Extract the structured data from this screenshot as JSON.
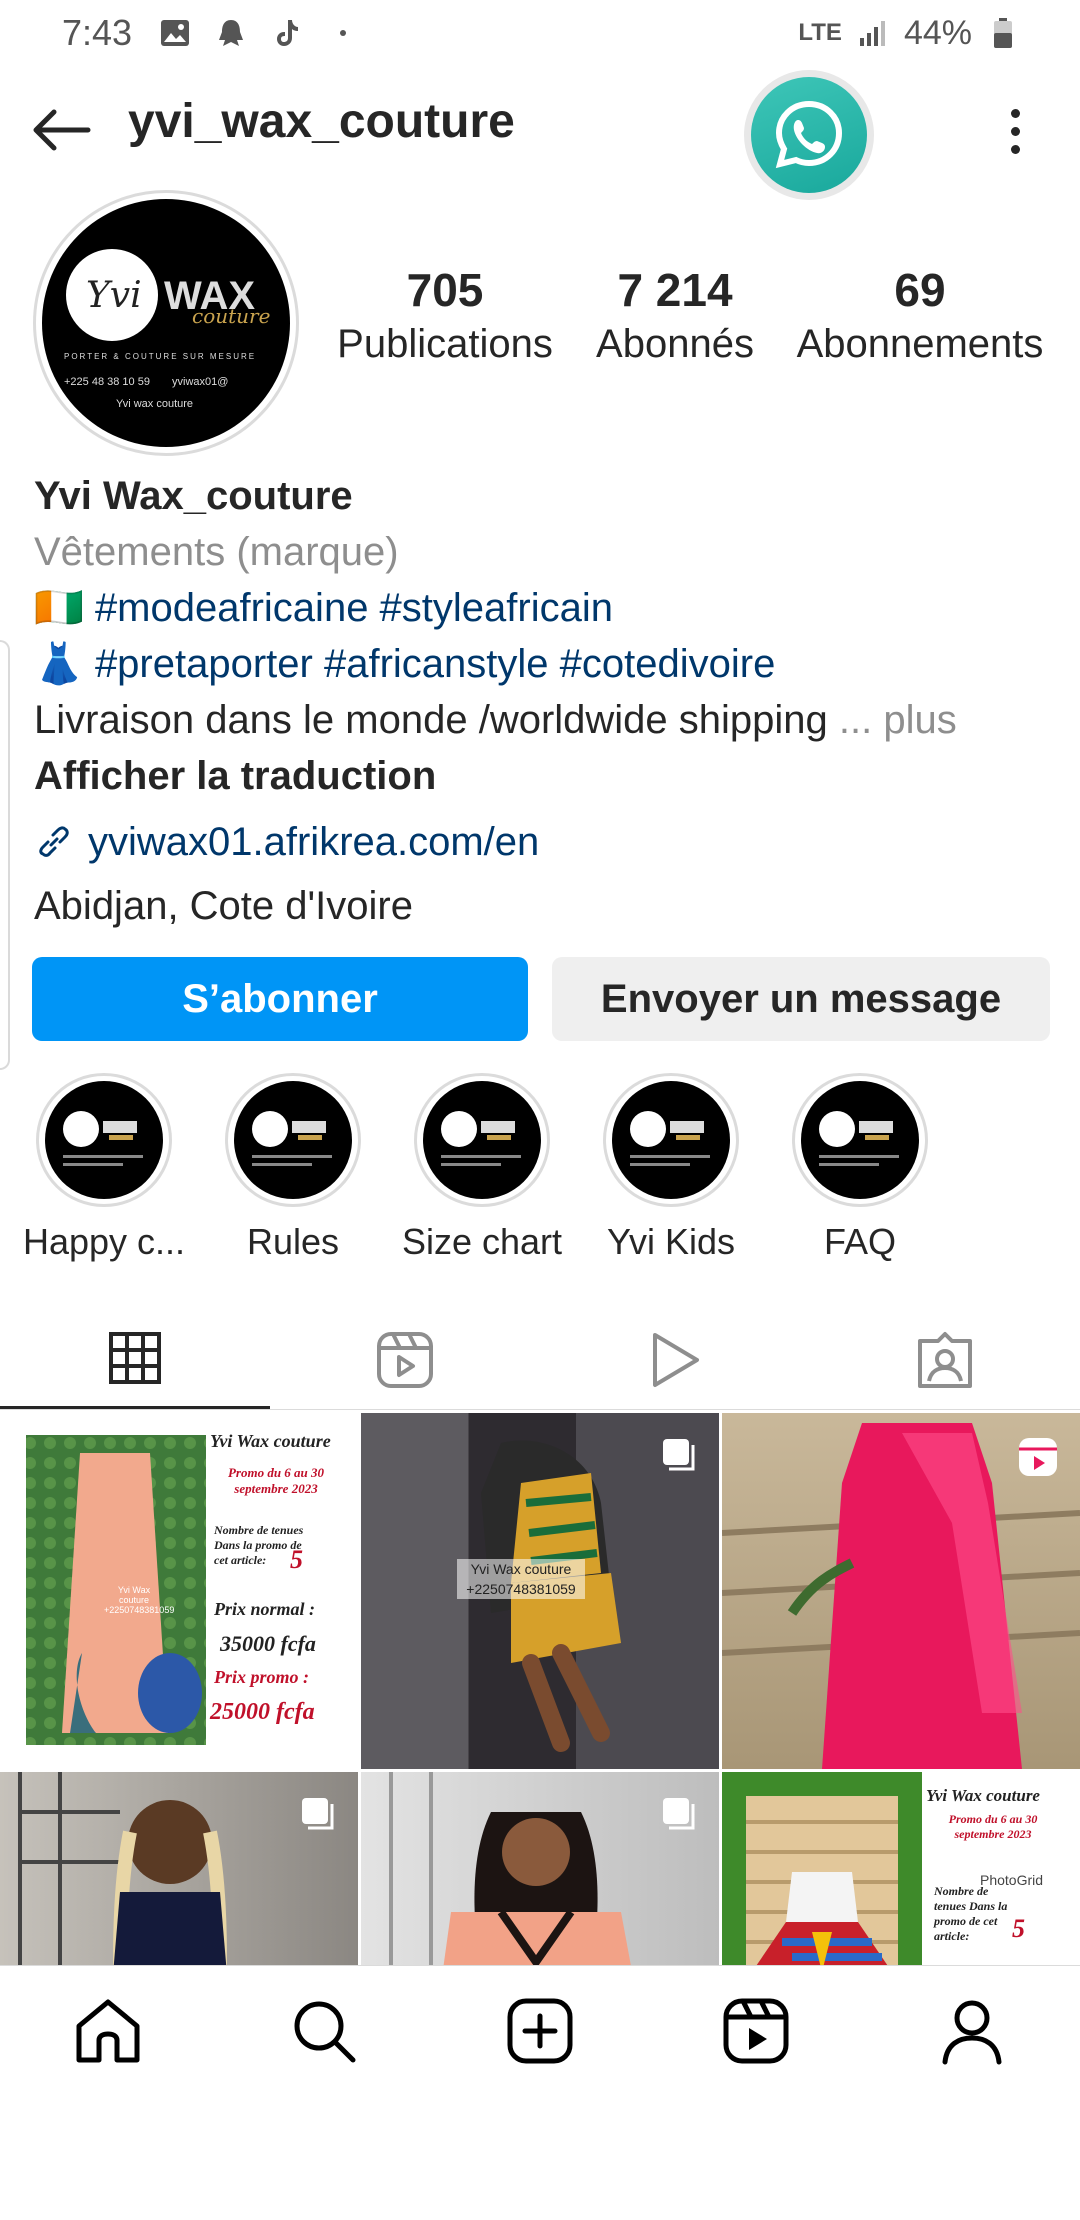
{
  "status_bar": {
    "time": "7:43",
    "network": "LTE",
    "battery": "44%",
    "icons": [
      "image-icon",
      "ghost-icon",
      "tiktok-icon",
      "dot-icon"
    ]
  },
  "header": {
    "username": "yvi_wax_couture",
    "back_icon": "arrow-left-icon",
    "whatsapp_icon": "whatsapp-icon",
    "menu_icon": "more-vertical-icon"
  },
  "profile": {
    "avatar_logo": {
      "script": "Yvi",
      "brand": "WAX",
      "sub": "couture",
      "tagline": "PORTER & COUTURE SUR MESURE",
      "phone": "+225 48 38 10 59",
      "handle": "yviwax01@",
      "social": "Yvi wax couture"
    },
    "stats": [
      {
        "value": "705",
        "label": "Publications"
      },
      {
        "value": "7 214",
        "label": "Abonnés"
      },
      {
        "value": "69",
        "label": "Abonnements"
      }
    ],
    "name": "Yvi Wax_couture",
    "category": "Vêtements (marque)",
    "bio_line1_emoji": "🇨🇮",
    "bio_line1": "#modeafricaine #styleafricain",
    "bio_line2_emoji": "👗",
    "bio_line2": "#pretaporter #africanstyle #cotedivoire",
    "bio_line3": "Livraison dans le monde /worldwide shipping",
    "more": "... plus",
    "translate": "Afficher la traduction",
    "link": "yviwax01.afrikrea.com/en",
    "location": "Abidjan, Cote d'Ivoire"
  },
  "actions": {
    "follow": "S’abonner",
    "message": "Envoyer un message"
  },
  "highlights": [
    {
      "label": "Happy c..."
    },
    {
      "label": "Rules"
    },
    {
      "label": "Size chart"
    },
    {
      "label": "Yvi Kids"
    },
    {
      "label": "FAQ"
    }
  ],
  "tabs": [
    "grid-icon",
    "reels-icon",
    "play-icon",
    "tagged-icon"
  ],
  "grid": {
    "post1": {
      "header": "Yvi Wax couture",
      "promo": "Promo du 6 au 30 septembre 2023",
      "stock_label": "Nombre de tenues Dans la promo de cet article:",
      "stock": "5",
      "normal_label": "Prix normal :",
      "normal_price": "35000 fcfa",
      "promo_label": "Prix promo :",
      "promo_price": "25000 fcfa",
      "watermark": "Yvi Wax couture +2250748381059"
    },
    "post2": {
      "watermark_line1": "Yvi Wax couture",
      "watermark_line2": "+2250748381059"
    },
    "post6": {
      "header": "Yvi Wax couture",
      "promo": "Promo du 6 au 30 septembre 2023",
      "app": "PhotoGrid",
      "stock_label": "Nombre de tenues Dans la promo de cet article:",
      "stock": "5"
    }
  },
  "bottom_nav": [
    "home-icon",
    "search-icon",
    "create-icon",
    "reels-icon",
    "profile-icon"
  ],
  "colors": {
    "primary_blue": "#0095f6",
    "link_blue": "#00376b",
    "whatsapp": "#25b5a6",
    "text": "#262626",
    "muted": "#8e8e8e"
  }
}
